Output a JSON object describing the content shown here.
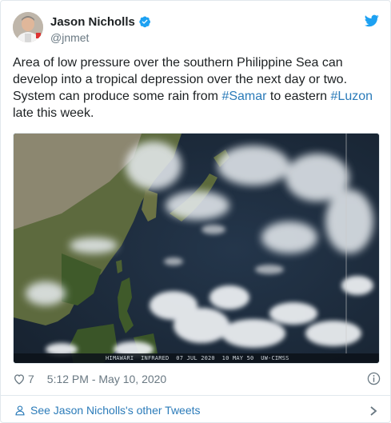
{
  "tweet": {
    "author_name": "Jason Nicholls",
    "author_handle": "@jnmet",
    "text_parts": [
      "Area of low pressure over the southern Philippine Sea can develop into a tropical depression over the next day or two. System can produce some rain from ",
      "#Samar",
      " to eastern ",
      "#Luzon",
      " late this week."
    ],
    "like_count": "7",
    "timestamp": "5:12 PM - May 10, 2020",
    "see_more_label": "See Jason Nicholls's other Tweets",
    "media_caption": "HIMAWARI  INFRARED  07 JUL 2020  10 MAY 50  UW-CIMSS"
  },
  "colors": {
    "link": "#2b7bb9",
    "text": "#1c2022",
    "muted": "#697882",
    "verified": "#1da1f2",
    "twitter_bird": "#1da1f2"
  },
  "icons": {
    "verified": "verified-badge-icon",
    "bird": "twitter-bird-icon",
    "like": "heart-icon",
    "info": "info-icon",
    "person": "person-icon",
    "chevron": "chevron-right-icon"
  }
}
